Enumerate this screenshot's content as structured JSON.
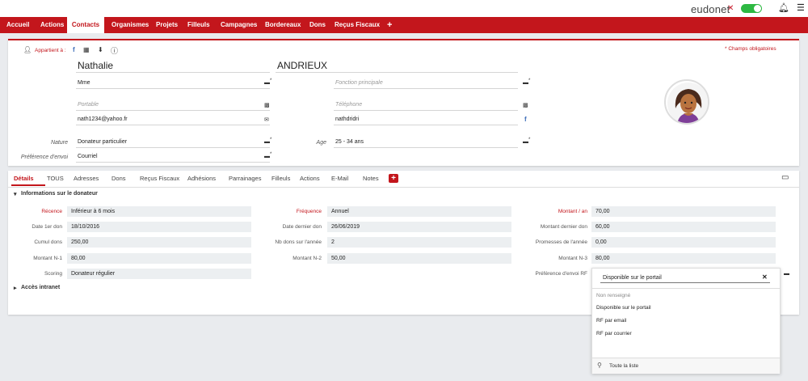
{
  "header": {
    "brand": "eudonet",
    "brand_mark": "✕"
  },
  "nav": {
    "items": [
      "Accueil",
      "Actions",
      "Contacts",
      "Organismes",
      "Projets",
      "Filleuls",
      "Campagnes",
      "Bordereaux",
      "Dons",
      "Reçus Fiscaux",
      "+"
    ],
    "active": "Contacts"
  },
  "card": {
    "owner_label": "Appartient à :",
    "required_note": "* Champs obligatoires",
    "firstname": "Nathalie",
    "lastname": "ANDRIEUX",
    "civility": "Mme",
    "fonction_placeholder": "Fonction principale",
    "portable_placeholder": "Portable",
    "telephone_placeholder": "Téléphone",
    "email": "nath1234@yahoo.fr",
    "facebook": "nathdridri",
    "nature_label": "Nature",
    "nature_value": "Donateur particulier",
    "age_label": "Age",
    "age_value": "25 - 34 ans",
    "pref_envoi_label": "Préférence d'envoi",
    "pref_envoi_value": "Courriel",
    "required_star": "*"
  },
  "tabs": {
    "items": [
      "Détails",
      "TOUS",
      "Adresses",
      "Dons",
      "Reçus Fiscaux",
      "Adhésions",
      "Parrainages",
      "Filleuls",
      "Actions",
      "E-Mail",
      "Notes"
    ],
    "active": "Détails"
  },
  "details": {
    "section_title": "Informations sur le donateur",
    "section2_title": "Accès intranet",
    "fields": {
      "recence_label": "Récence",
      "recence_value": "Inférieur à 6 mois",
      "frequence_label": "Fréquence",
      "frequence_value": "Annuel",
      "montant_an_label": "Montant / an",
      "montant_an_value": "70,00",
      "date1_label": "Date 1er don",
      "date1_value": "18/10/2016",
      "date_dernier_label": "Date dernier don",
      "date_dernier_value": "26/06/2019",
      "montant_dernier_label": "Montant dernier don",
      "montant_dernier_value": "60,00",
      "cumul_label": "Cumul dons",
      "cumul_value": "250,00",
      "nb_dons_label": "Nb dons sur l'année",
      "nb_dons_value": "2",
      "promesses_label": "Promesses de l'année",
      "promesses_value": "0,00",
      "n1_label": "Montant N-1",
      "n1_value": "80,00",
      "n2_label": "Montant N-2",
      "n2_value": "50,00",
      "n3_label": "Montant N-3",
      "n3_value": "80,00",
      "scoring_label": "Scoring",
      "scoring_value": "Donateur régulier",
      "pref_rf_label": "Préférence d'envoi RF"
    }
  },
  "dropdown": {
    "input_value": "Disponible sur le portail",
    "options": [
      "Non renseigné",
      "Disponible sur le portail",
      "RF par email",
      "RF par courrier"
    ],
    "footer": "Toute la liste"
  },
  "colors": {
    "brand_red": "#c3161c",
    "toggle_green": "#2db842",
    "facebook_blue": "#3b6bb8"
  }
}
